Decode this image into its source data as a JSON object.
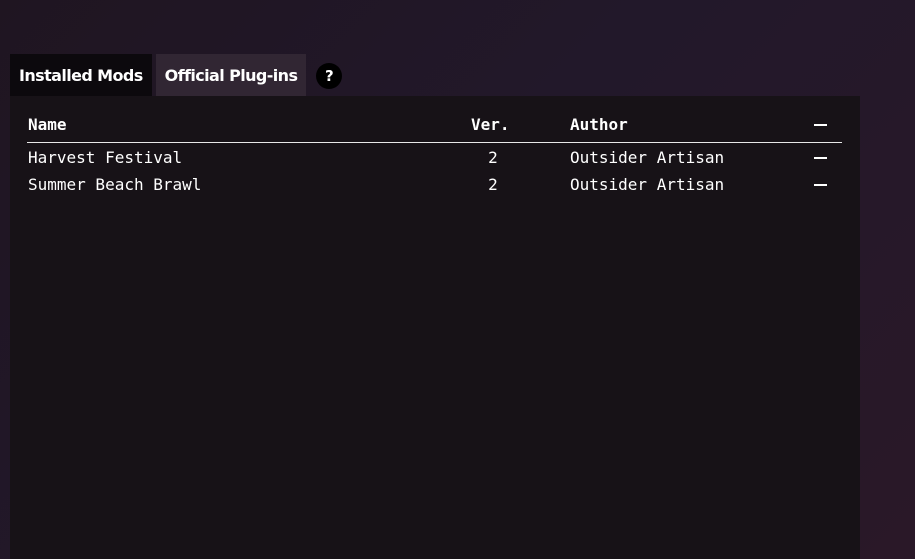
{
  "tabs": [
    {
      "label": "Installed Mods",
      "active": true
    },
    {
      "label": "Official Plug-ins",
      "active": false
    }
  ],
  "help": {
    "label": "?"
  },
  "table": {
    "headers": {
      "name": "Name",
      "version": "Ver.",
      "author": "Author",
      "remove": "–"
    },
    "rows": [
      {
        "name": "Harvest Festival",
        "version": "2",
        "author": "Outsider Artisan"
      },
      {
        "name": "Summer Beach Brawl",
        "version": "2",
        "author": "Outsider Artisan"
      }
    ]
  },
  "colors": {
    "panel_background": "#171217",
    "active_tab": "#0c090d",
    "inactive_tab": "#312633"
  }
}
